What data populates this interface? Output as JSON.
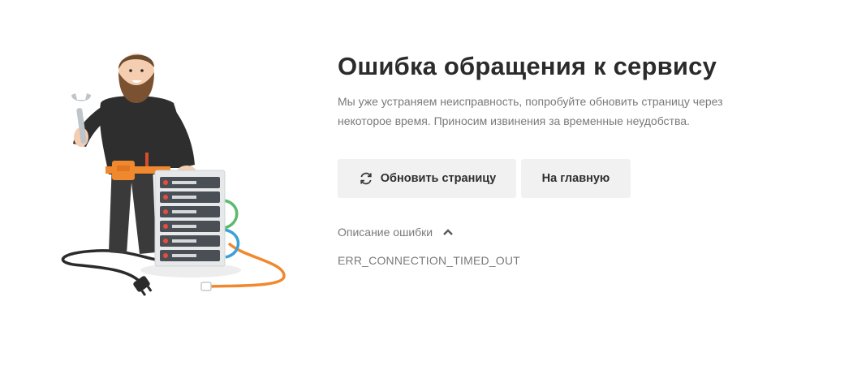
{
  "error_page": {
    "title": "Ошибка обращения к сервису",
    "description": "Мы уже устраняем неисправность, попробуйте обновить страницу через некоторое время. Приносим извинения за временные неудобства.",
    "buttons": {
      "refresh_label": "Обновить страницу",
      "home_label": "На главную"
    },
    "details": {
      "toggle_label": "Описание ошибки",
      "expanded": true,
      "error_code": "ERR_CONNECTION_TIMED_OUT"
    }
  },
  "icons": {
    "refresh": "refresh-icon",
    "chevron": "chevron-up-icon"
  },
  "colors": {
    "background": "#ffffff",
    "title": "#2b2b2b",
    "muted_text": "#7a7a7a",
    "button_bg": "#f1f1f1",
    "accent_orange": "#f0892e",
    "shirt": "#2e2e2e"
  }
}
